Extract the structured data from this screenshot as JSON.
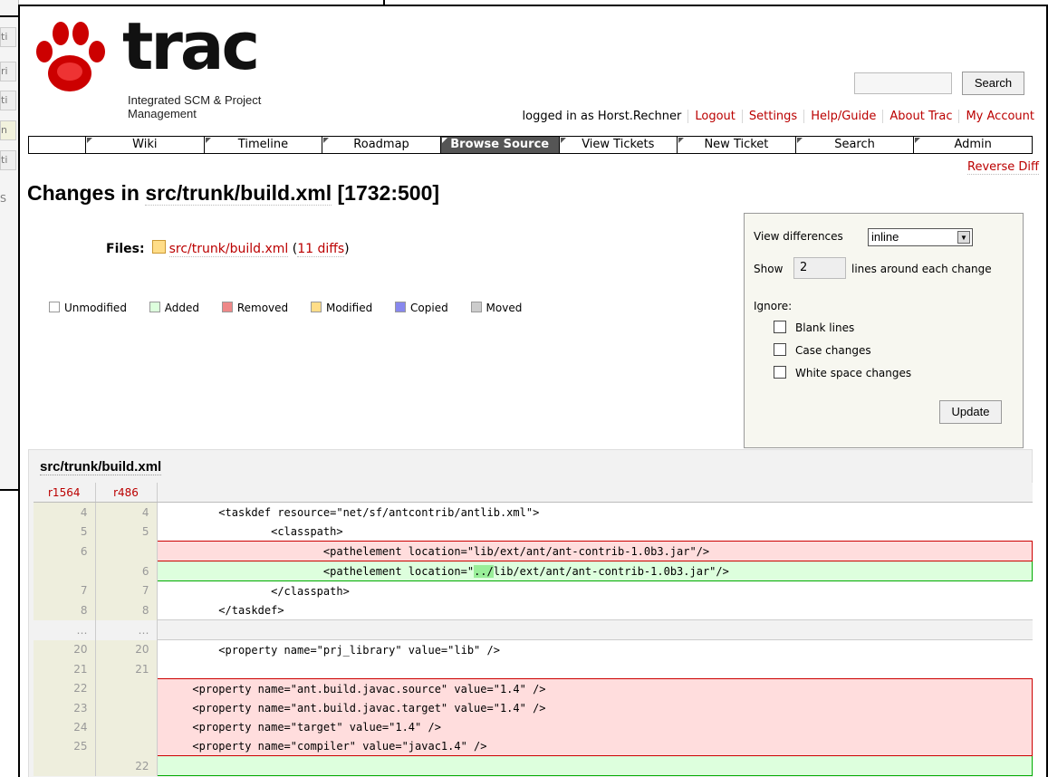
{
  "bg_tabs": [
    "ti",
    "ri",
    "ti",
    "n",
    "ti",
    "S"
  ],
  "logo": {
    "word": "trac",
    "tagline": "Integrated SCM & Project Management"
  },
  "search": {
    "button": "Search",
    "placeholder": ""
  },
  "metanav": {
    "logged_in": "logged in as Horst.Rechner",
    "items": [
      "Logout",
      "Settings",
      "Help/Guide",
      "About Trac",
      "My Account"
    ]
  },
  "mainnav": [
    "Wiki",
    "Timeline",
    "Roadmap",
    "Browse Source",
    "View Tickets",
    "New Ticket",
    "Search",
    "Admin"
  ],
  "mainnav_active": "Browse Source",
  "reverse_diff": "Reverse Diff",
  "title": {
    "prefix": "Changes in ",
    "path": "src/trunk/build.xml",
    "rev": " [1732:500]"
  },
  "files": {
    "label": "Files:",
    "file": "src/trunk/build.xml",
    "diffs_open": " (",
    "diffs": "11 diffs",
    "diffs_close": ")"
  },
  "legend": [
    {
      "label": "Unmodified",
      "color": "#ffffff"
    },
    {
      "label": "Added",
      "color": "#ddffdd"
    },
    {
      "label": "Removed",
      "color": "#ee8888"
    },
    {
      "label": "Modified",
      "color": "#ffdd88"
    },
    {
      "label": "Copied",
      "color": "#8888ee"
    },
    {
      "label": "Moved",
      "color": "#cccccc"
    }
  ],
  "prefs": {
    "view_label": "View differences",
    "view_value": "inline",
    "show_label": "Show",
    "show_value": "2",
    "around_label": "lines around each change",
    "ignore_label": "Ignore:",
    "options": [
      "Blank lines",
      "Case changes",
      "White space changes"
    ],
    "update": "Update"
  },
  "diff": {
    "file": "src/trunk/build.xml",
    "old_rev": "r1564",
    "new_rev": "r486",
    "rows": [
      {
        "type": "ctx",
        "old": "4",
        "new": "4",
        "text": "        <taskdef resource=\"net/sf/antcontrib/antlib.xml\">"
      },
      {
        "type": "ctx",
        "old": "5",
        "new": "5",
        "text": "                <classpath>"
      },
      {
        "type": "rem",
        "old": "6",
        "new": "",
        "text": "                        <pathelement location=\"lib/ext/ant/ant-contrib-1.0b3.jar\"/>"
      },
      {
        "type": "add",
        "old": "",
        "new": "6",
        "pre": "                        <pathelement location=\"",
        "ins": "../",
        "post": "lib/ext/ant/ant-contrib-1.0b3.jar\"/>"
      },
      {
        "type": "ctx",
        "old": "7",
        "new": "7",
        "text": "                </classpath>"
      },
      {
        "type": "ctx",
        "old": "8",
        "new": "8",
        "text": "        </taskdef>"
      },
      {
        "type": "skip",
        "old": "…",
        "new": "…",
        "text": ""
      },
      {
        "type": "ctx",
        "old": "20",
        "new": "20",
        "text": "        <property name=\"prj_library\" value=\"lib\" />"
      },
      {
        "type": "ctx",
        "old": "21",
        "new": "21",
        "text": ""
      },
      {
        "type": "rem",
        "old": "22",
        "new": "",
        "text": "    <property name=\"ant.build.javac.source\" value=\"1.4\" />"
      },
      {
        "type": "rem",
        "old": "23",
        "new": "",
        "text": "    <property name=\"ant.build.javac.target\" value=\"1.4\" />"
      },
      {
        "type": "rem",
        "old": "24",
        "new": "",
        "text": "    <property name=\"target\" value=\"1.4\" />"
      },
      {
        "type": "rem",
        "old": "25",
        "new": "",
        "text": "    <property name=\"compiler\" value=\"javac1.4\" />"
      },
      {
        "type": "add",
        "old": "",
        "new": "22",
        "pre": "",
        "ins": "",
        "post": ""
      }
    ]
  }
}
